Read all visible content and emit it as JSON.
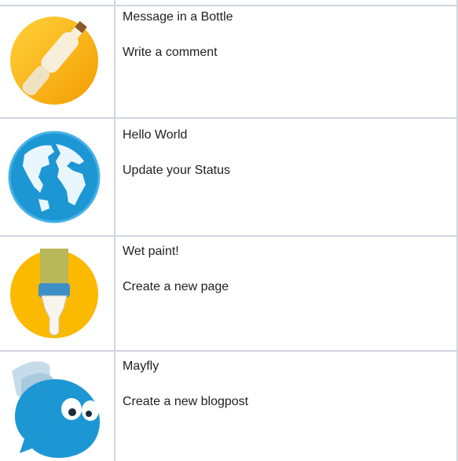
{
  "rows": [
    {
      "title": "Message in a Bottle",
      "action": "Write a comment",
      "icon": "message-bottle-icon"
    },
    {
      "title": "Hello World",
      "action": "Update your Status",
      "icon": "globe-icon"
    },
    {
      "title": "Wet paint!",
      "action": "Create a new page",
      "icon": "paintbrush-icon"
    },
    {
      "title": "Mayfly",
      "action": "Create a new blogpost",
      "icon": "mayfly-bubble-icon"
    }
  ],
  "colors": {
    "border": "#cfd6df",
    "gold": "#fbb900",
    "gold_dark": "#f39c00",
    "blue": "#1d97d4",
    "blue_light": "#48b2e6",
    "text": "#1f1f1f"
  }
}
